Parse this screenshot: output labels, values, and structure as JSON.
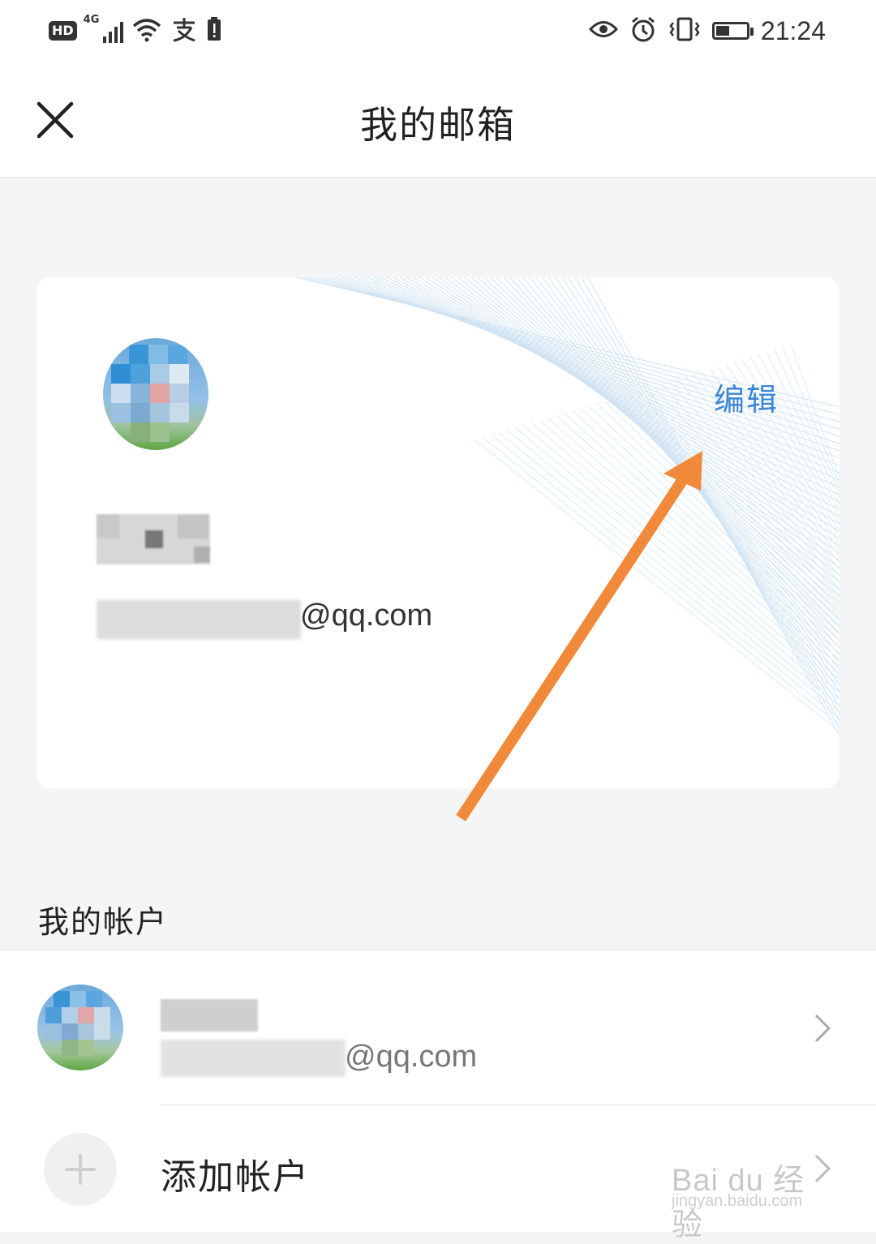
{
  "status_bar": {
    "hd_badge": "HD",
    "network": "4G",
    "time": "21:24",
    "battery_level": 0.35
  },
  "header": {
    "title": "我的邮箱",
    "close_icon": "close-icon"
  },
  "profile_card": {
    "edit_label": "编辑",
    "email_suffix": "@qq.com"
  },
  "section": {
    "title": "我的帐户"
  },
  "accounts": [
    {
      "email_suffix": "@qq.com"
    }
  ],
  "add_account": {
    "label": "添加帐户",
    "icon": "plus-icon"
  },
  "watermark": {
    "brand": "Bai du 经验",
    "domain": "jingyan.baidu.com"
  },
  "colors": {
    "accent": "#3a86d6",
    "annotation_arrow": "#f0893a"
  }
}
